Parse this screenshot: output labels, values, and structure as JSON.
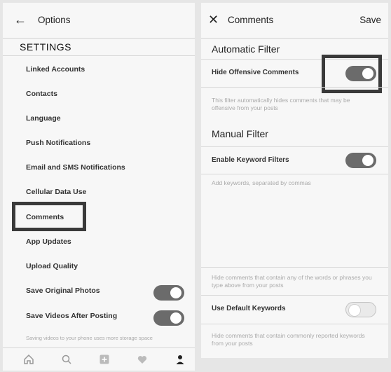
{
  "left": {
    "header_title": "Options",
    "section_title": "SETTINGS",
    "items": [
      {
        "label": "Linked Accounts"
      },
      {
        "label": "Contacts"
      },
      {
        "label": "Language"
      },
      {
        "label": "Push Notifications"
      },
      {
        "label": "Email and SMS Notifications"
      },
      {
        "label": "Cellular Data Use"
      },
      {
        "label": "Comments"
      },
      {
        "label": "App Updates"
      },
      {
        "label": "Upload Quality"
      },
      {
        "label": "Save Original Photos",
        "toggle": "on"
      },
      {
        "label": "Save Videos After Posting",
        "toggle": "on"
      }
    ],
    "footer_note": "Saving videos to your phone uses more storage space",
    "tabs": [
      {
        "icon": "home-icon"
      },
      {
        "icon": "search-icon"
      },
      {
        "icon": "add-post-icon"
      },
      {
        "icon": "heart-icon"
      },
      {
        "icon": "profile-icon"
      }
    ]
  },
  "right": {
    "header_title": "Comments",
    "save_label": "Save",
    "auto_filter_title": "Automatic Filter",
    "hide_offensive_label": "Hide Offensive Comments",
    "hide_offensive_toggle": "on",
    "hide_offensive_note": "This filter automatically hides comments that may be offensive from your posts",
    "manual_filter_title": "Manual Filter",
    "keyword_filter_label": "Enable Keyword Filters",
    "keyword_filter_toggle": "on",
    "keyword_placeholder": "Add keywords, separated by commas",
    "keyword_note": "Hide comments that contain any of the words or phrases you type above from your posts",
    "default_keywords_label": "Use Default Keywords",
    "default_keywords_toggle": "off",
    "default_keywords_note": "Hide comments that contain commonly reported keywords from your posts"
  },
  "colors": {
    "toggle_on": "#6b6b6b",
    "highlight_box": "#3a3a3a"
  }
}
